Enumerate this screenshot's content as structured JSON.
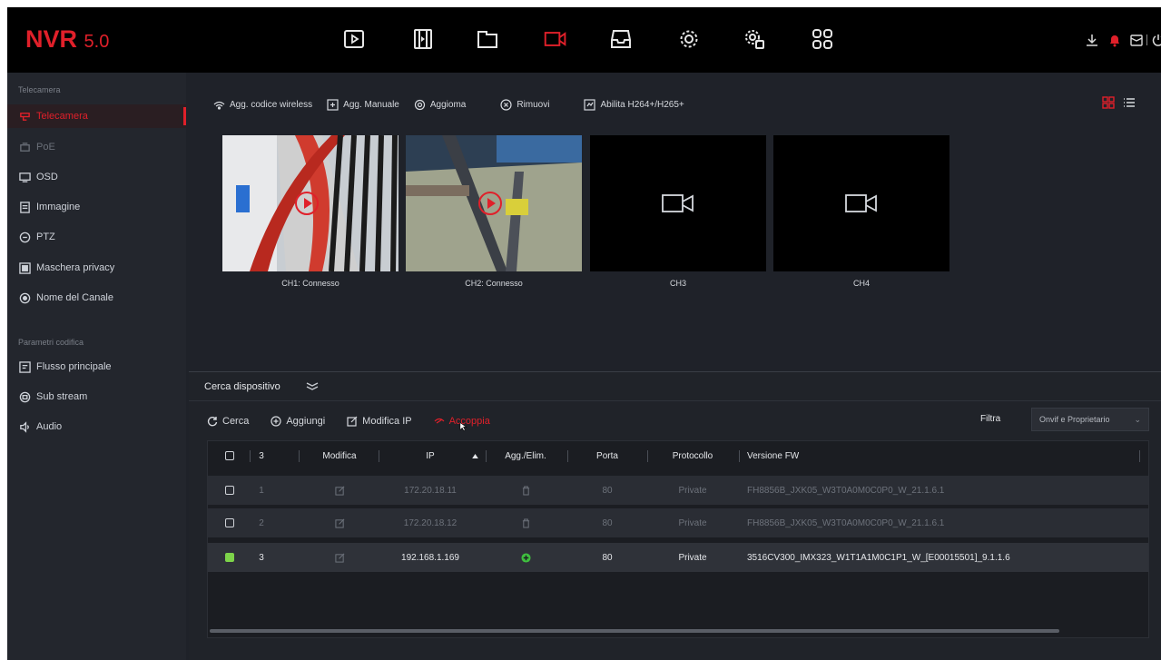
{
  "app": {
    "logo": "NVR",
    "version": "5.0"
  },
  "topbar": {
    "icons": [
      "playback-icon",
      "video-clip-icon",
      "folder-icon",
      "camera-icon",
      "storage-icon",
      "settings-icon",
      "system-settings-icon",
      "apps-grid-icon"
    ],
    "active_icon": "camera-icon",
    "right_icons": [
      "download-icon",
      "alarm-icon",
      "message-icon",
      "power-icon"
    ]
  },
  "sidebar": {
    "section1": "Telecamera",
    "items1": [
      {
        "label": "Telecamera",
        "icon": "camera-icon",
        "active": true
      },
      {
        "label": "PoE",
        "icon": "poe-icon",
        "disabled": true
      },
      {
        "label": "OSD",
        "icon": "monitor-icon"
      },
      {
        "label": "Immagine",
        "icon": "image-icon"
      },
      {
        "label": "PTZ",
        "icon": "ptz-icon"
      },
      {
        "label": "Maschera privacy",
        "icon": "privacy-mask-icon"
      },
      {
        "label": "Nome del Canale",
        "icon": "channel-name-icon"
      }
    ],
    "section2": "Parametri codifica",
    "items2": [
      {
        "label": "Flusso principale",
        "icon": "main-stream-icon"
      },
      {
        "label": "Sub stream",
        "icon": "sub-stream-icon"
      },
      {
        "label": "Audio",
        "icon": "audio-icon"
      }
    ]
  },
  "toolbar": {
    "add_wireless": "Agg. codice wireless",
    "add_manual": "Agg. Manuale",
    "refresh": "Aggioma",
    "remove": "Rimuovi",
    "enable_h264": "Abilita H264+/H265+"
  },
  "channels": [
    {
      "label": "CH1: Connesso",
      "connected": true
    },
    {
      "label": "CH2: Connesso",
      "connected": true
    },
    {
      "label": "CH3",
      "connected": false
    },
    {
      "label": "CH4",
      "connected": false
    }
  ],
  "search": {
    "title": "Cerca dispositivo",
    "actions": {
      "search": "Cerca",
      "add": "Aggiungi",
      "modify_ip": "Modifica IP",
      "pair": "Accoppia"
    },
    "filter_label": "Filtra",
    "filter_value": "Onvif e Proprietario",
    "columns": {
      "count": "3",
      "modify": "Modifica",
      "ip": "IP",
      "add_del": "Agg./Elim.",
      "port": "Porta",
      "protocol": "Protocollo",
      "fw": "Versione FW"
    },
    "rows": [
      {
        "index": "1",
        "ip": "172.20.18.11",
        "port": "80",
        "protocol": "Private",
        "fw": "FH8856B_JXK05_W3T0A0M0C0P0_W_21.1.6.1",
        "added": true,
        "checked": false
      },
      {
        "index": "2",
        "ip": "172.20.18.12",
        "port": "80",
        "protocol": "Private",
        "fw": "FH8856B_JXK05_W3T0A0M0C0P0_W_21.1.6.1",
        "added": true,
        "checked": false
      },
      {
        "index": "3",
        "ip": "192.168.1.169",
        "port": "80",
        "protocol": "Private",
        "fw": "3516CV300_IMX323_W1T1A1M0C1P1_W_[E00015501]_9.1.1.6",
        "added": false,
        "checked": true
      }
    ]
  },
  "colors": {
    "accent": "#e0202a",
    "add_green": "#3fbf3f",
    "check_green": "#7dd34a",
    "bg": "#1f2229",
    "topbar": "#000000"
  }
}
